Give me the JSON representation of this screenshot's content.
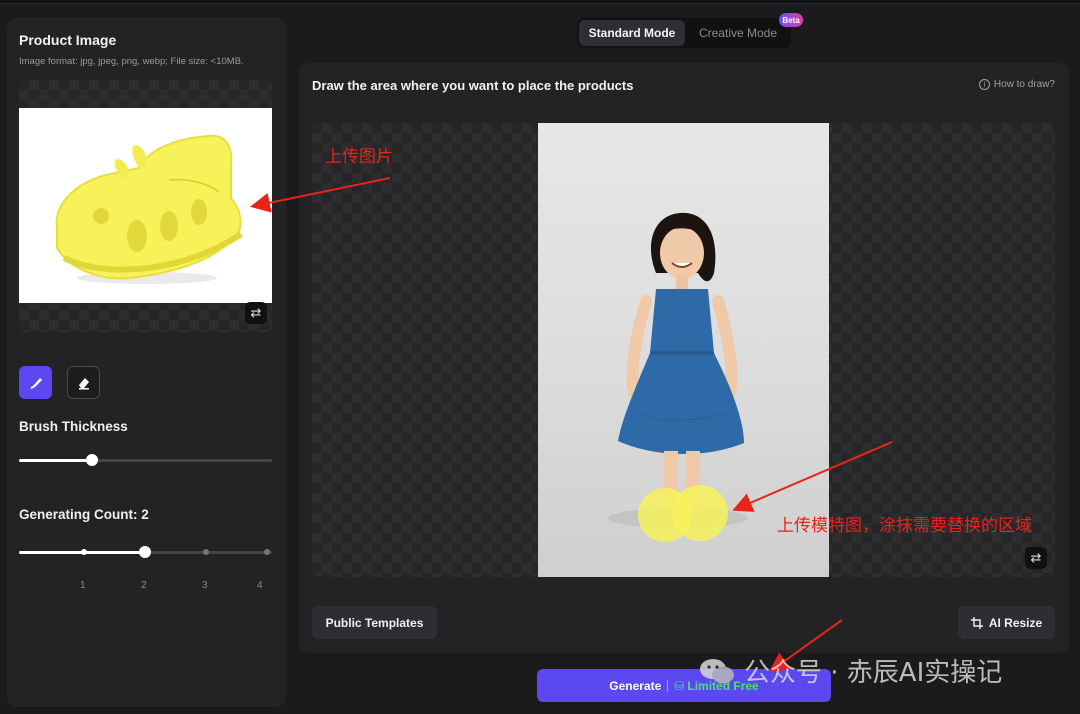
{
  "left_panel": {
    "title": "Product Image",
    "subtitle": "Image format: jpg, jpeg, png, webp; File size: <10MB.",
    "brush_thickness_label": "Brush Thickness",
    "brush_thickness_level": 0.29,
    "generating_count_label": "Generating Count: 2",
    "generating_count_value": 2,
    "count_ticks": [
      "1",
      "2",
      "3",
      "4"
    ]
  },
  "mode": {
    "standard": "Standard Mode",
    "creative": "Creative Mode",
    "beta_badge": "Beta"
  },
  "canvas": {
    "title": "Draw the area where you want to place the products",
    "how_to": "How to draw?",
    "public_templates": "Public Templates",
    "ai_resize": "AI Resize"
  },
  "generate": {
    "label": "Generate",
    "free_label": "Limited Free"
  },
  "annotations": {
    "upload_image": "上传图片",
    "upload_model": "上传模特图，涂抹需要替换的区域"
  },
  "watermark": "公众号 · 赤辰AI实操记",
  "icons": [
    "swap-icon",
    "brush-icon",
    "eraser-icon",
    "info-icon",
    "crop-icon",
    "coin-icon",
    "wechat-icon"
  ],
  "colors": {
    "accent": "#5b48f0",
    "highlight": "#f7f25a",
    "annotation": "#e8231a",
    "free": "#49e07a",
    "dress": "#2f6aa8"
  }
}
